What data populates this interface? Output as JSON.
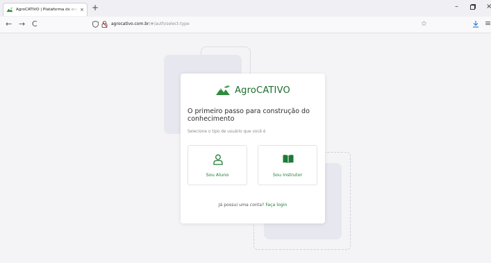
{
  "browser": {
    "tab_title": "AgroCATIVO | Plataforma de ensino",
    "tab_close": "×",
    "new_tab": "+",
    "back": "←",
    "forward": "→",
    "reload": "C",
    "url_domain": "agrocativo.com.br",
    "url_path": "/#/auth/select-type",
    "bookmark_star": "☆",
    "menu": "≡",
    "minimize": "–",
    "restore": "▫",
    "close": "×"
  },
  "card": {
    "brand_name": "AgroCATIVO",
    "headline": "O primeiro passo para construção do conhecimento",
    "subtitle": "Selecione o tipo de usuário que você é",
    "options": [
      {
        "label": "Sou Aluno",
        "icon": "user-icon"
      },
      {
        "label": "Sou Instrutor",
        "icon": "book-icon"
      }
    ],
    "login_prompt": "Já possui uma conta?",
    "login_link": "Faça login"
  },
  "colors": {
    "brand_green": "#1d6b2e",
    "accent_green": "#1d7a35",
    "page_bg": "#f4f4f6",
    "deco_fill": "#e6e7ef"
  }
}
